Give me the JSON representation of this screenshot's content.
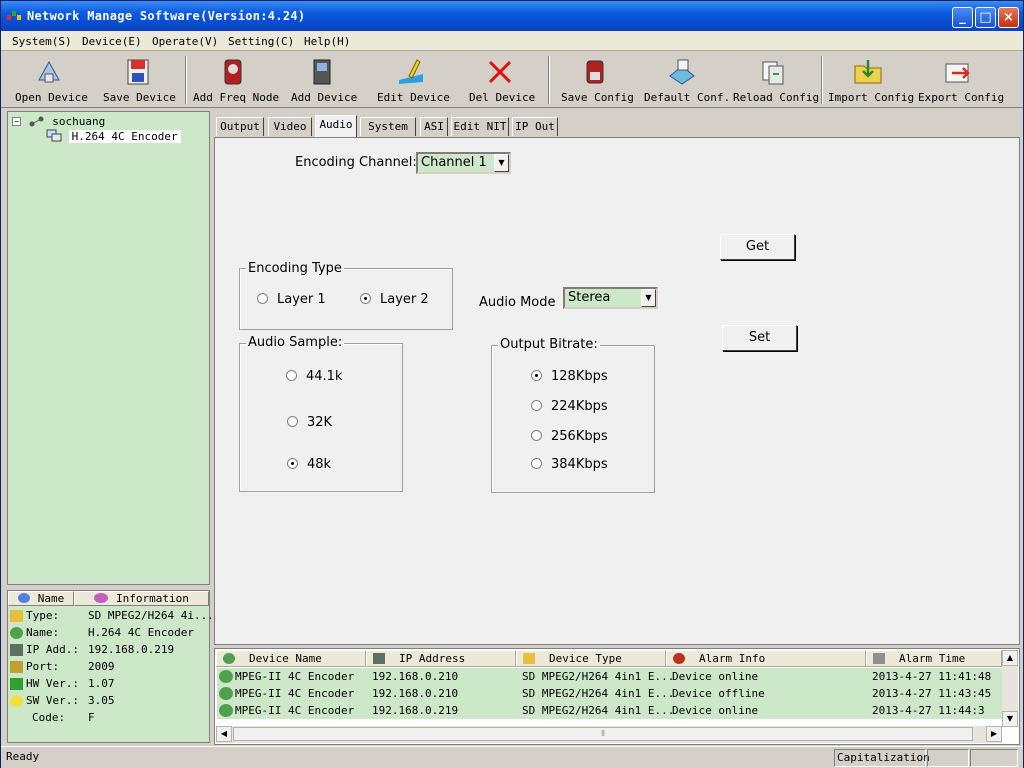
{
  "window": {
    "title": "Network Manage Software(Version:4.24)"
  },
  "menu": [
    "System(S)",
    "Device(E)",
    "Operate(V)",
    "Setting(C)",
    "Help(H)"
  ],
  "toolbar": {
    "open_device": "Open Device",
    "save_device": "Save Device",
    "add_freq_node": "Add Freq Node",
    "add_device": "Add Device",
    "edit_device": "Edit Device",
    "del_device": "Del Device",
    "save_config": "Save Config",
    "default_conf": "Default Conf.",
    "reload_config": "Reload Config",
    "import_config": "Import Config",
    "export_config": "Export Config"
  },
  "tree": {
    "root": "sochuang",
    "child": "H.264 4C Encoder"
  },
  "info": {
    "headers": {
      "name": "Name",
      "information": "Information"
    },
    "rows": [
      {
        "key": "Type:",
        "value": "SD MPEG2/H264 4i..."
      },
      {
        "key": "Name:",
        "value": "H.264 4C Encoder"
      },
      {
        "key": "IP Add.:",
        "value": "192.168.0.219"
      },
      {
        "key": "Port:",
        "value": "2009"
      },
      {
        "key": "HW Ver.:",
        "value": "1.07"
      },
      {
        "key": "SW Ver.:",
        "value": "3.05"
      },
      {
        "key": "Code:",
        "value": "F"
      }
    ]
  },
  "tabs": [
    "Output",
    "Video",
    "Audio",
    "System",
    "ASI",
    "Edit NIT",
    "IP Out"
  ],
  "active_tab": "Audio",
  "audio": {
    "encoding_channel_label": "Encoding Channel:",
    "encoding_channel_value": "Channel 1",
    "encoding_type_title": "Encoding Type",
    "layer1": "Layer 1",
    "layer2": "Layer 2",
    "audio_mode_label": "Audio Mode",
    "audio_mode_value": "Sterea",
    "audio_sample_title": "Audio Sample:",
    "sample_44": "44.1k",
    "sample_32": "32K",
    "sample_48": "48k",
    "output_bitrate_title": "Output Bitrate:",
    "br_128": "128Kbps",
    "br_224": "224Kbps",
    "br_256": "256Kbps",
    "br_384": "384Kbps",
    "get_label": "Get",
    "set_label": "Set"
  },
  "alarm_list": {
    "headers": {
      "device_name": "Device Name",
      "ip_address": "IP Address",
      "device_type": "Device Type",
      "alarm_info": "Alarm Info",
      "alarm_time": "Alarm Time"
    },
    "rows": [
      {
        "name": "MPEG-II 4C Encoder",
        "ip": "192.168.0.210",
        "type": "SD MPEG2/H264 4in1 E...",
        "alarm": "Device online",
        "time": "2013-4-27 11:41:48"
      },
      {
        "name": "MPEG-II 4C Encoder",
        "ip": "192.168.0.210",
        "type": "SD MPEG2/H264 4in1 E...",
        "alarm": "Device offline",
        "time": "2013-4-27 11:43:45"
      },
      {
        "name": "MPEG-II 4C Encoder",
        "ip": "192.168.0.219",
        "type": "SD MPEG2/H264 4in1 E...",
        "alarm": "Device online",
        "time": "2013-4-27 11:44:3"
      }
    ]
  },
  "status": {
    "text": "Ready",
    "caps": "Capitalization"
  },
  "colors": {
    "panel_green": "#cde8c8",
    "title_blue": "#0a5ae0",
    "face": "#d4d0c8"
  }
}
